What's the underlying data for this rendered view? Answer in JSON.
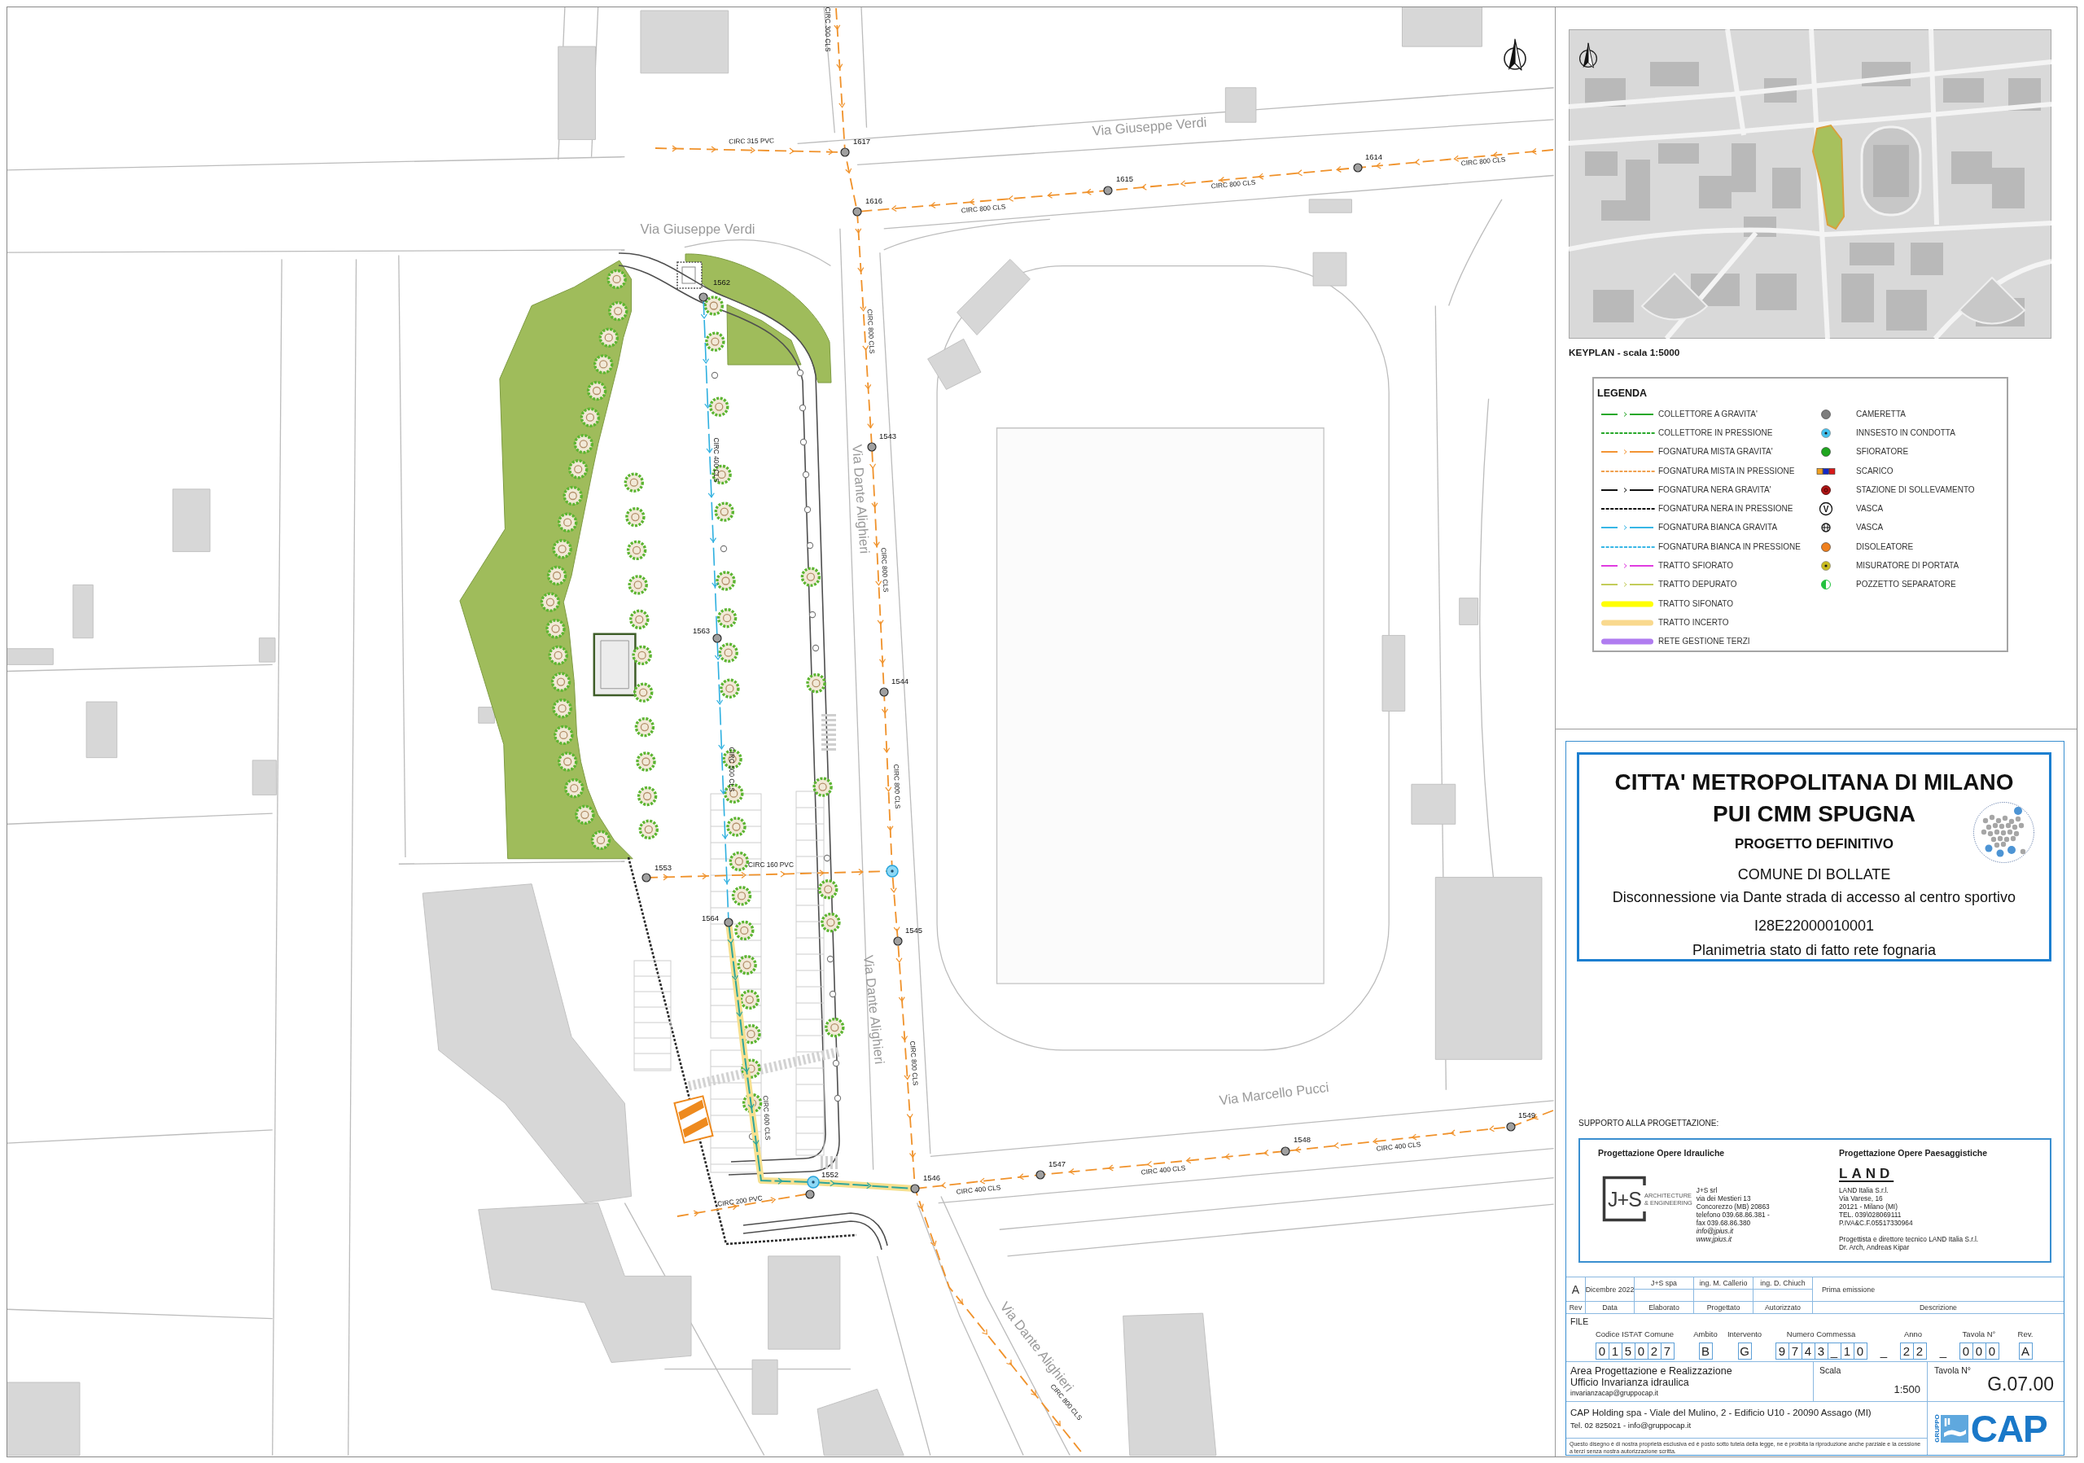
{
  "map": {
    "streets": [
      {
        "name": "Via Giuseppe Verdi"
      },
      {
        "name": "Via Giuseppe Verdi"
      },
      {
        "name": "Via Dante Alighieri"
      },
      {
        "name": "Via Dante Alighieri"
      },
      {
        "name": "Via Marcello Pucci"
      },
      {
        "name": "Via Dante Alighieri"
      }
    ],
    "pipes": [
      {
        "kind": "mista",
        "labels": [
          "CIRC 315 PVC"
        ]
      },
      {
        "kind": "mista",
        "labels": [
          "CIRC 800 CLS",
          "CIRC 800 CLS",
          "CIRC 800 CLS"
        ]
      },
      {
        "kind": "mista",
        "labels": [
          "CIRC 300 CLS",
          "CIRC 800 CLS",
          "CIRC 800 CLS",
          "CIRC 800 CLS",
          "CIRC 800 CLS",
          "CIRC 800 CLS"
        ]
      },
      {
        "kind": "mista",
        "labels": [
          "CIRC 400 CLS",
          "CIRC 400 CLS",
          "CIRC 400 CLS"
        ]
      },
      {
        "kind": "mista",
        "labels": [
          "CIRC 160 PVC"
        ]
      },
      {
        "kind": "mista",
        "labels": [
          "CIRC 200 PVC"
        ]
      },
      {
        "kind": "bianca",
        "labels": [
          "CIRC 400 CLS",
          "CIRC 500 CLS"
        ]
      },
      {
        "kind": "collettore",
        "labels": [
          "CIRC 600 CLS"
        ]
      }
    ],
    "nodes": [
      {
        "kind": "manhole",
        "label": "1617"
      },
      {
        "kind": "manhole",
        "label": "1616"
      },
      {
        "kind": "manhole",
        "label": "1615"
      },
      {
        "kind": "manhole",
        "label": "1614"
      },
      {
        "kind": "manhole",
        "label": "1562"
      },
      {
        "kind": "manhole",
        "label": "1543"
      },
      {
        "kind": "manhole",
        "label": "1563"
      },
      {
        "kind": "manhole",
        "label": "1544"
      },
      {
        "kind": "manhole",
        "label": "1553"
      },
      {
        "kind": "junction"
      },
      {
        "kind": "manhole",
        "label": "1545"
      },
      {
        "kind": "manhole",
        "label": "1564"
      },
      {
        "kind": "junction",
        "label": "1552"
      },
      {
        "kind": "manhole"
      },
      {
        "kind": "manhole",
        "label": "1546"
      },
      {
        "kind": "manhole",
        "label": "1547"
      },
      {
        "kind": "manhole",
        "label": "1548"
      },
      {
        "kind": "manhole",
        "label": "1549"
      }
    ]
  },
  "keyplan": {
    "caption": "KEYPLAN - scala 1:5000"
  },
  "legend": {
    "title": "LEGENDA",
    "lines": [
      {
        "label": "COLLETTORE A GRAVITA'",
        "kind": "gravity",
        "color": "#27a82a"
      },
      {
        "label": "COLLETTORE IN PRESSIONE",
        "kind": "pressure",
        "color": "#27a82a"
      },
      {
        "label": "FOGNATURA MISTA GRAVITA'",
        "kind": "gravity",
        "color": "#f39433"
      },
      {
        "label": "FOGNATURA MISTA IN PRESSIONE",
        "kind": "pressure",
        "color": "#f0a04e"
      },
      {
        "label": "FOGNATURA NERA GRAVITA'",
        "kind": "gravity",
        "color": "#111111"
      },
      {
        "label": "FOGNATURA NERA IN PRESSIONE",
        "kind": "pressure",
        "color": "#111111"
      },
      {
        "label": "FOGNATURA BIANCA GRAVITA",
        "kind": "gravity",
        "color": "#37b6e6"
      },
      {
        "label": "FOGNATURA BIANCA IN PRESSIONE",
        "kind": "pressure",
        "color": "#37b6e6"
      },
      {
        "label": "TRATTO SFIORATO",
        "kind": "gravity",
        "color": "#e03ce0"
      },
      {
        "label": "TRATTO DEPURATO",
        "kind": "gravity",
        "color": "#c3cc5a"
      },
      {
        "label": "TRATTO SIFONATO",
        "kind": "band",
        "color": "#ffff00"
      },
      {
        "label": "TRATTO INCERTO",
        "kind": "band",
        "color": "#f9d98e"
      },
      {
        "label": "RETE GESTIONE TERZI",
        "kind": "band",
        "color": "#b07cf0"
      }
    ],
    "symbols": [
      {
        "label": "CAMERETTA",
        "kind": "dot",
        "color": "#7d7d7d"
      },
      {
        "label": "INNSESTO IN CONDOTTA",
        "kind": "ring-dot",
        "color": "#45c3f0"
      },
      {
        "label": "SFIORATORE",
        "kind": "dot",
        "color": "#1fa61f"
      },
      {
        "label": "SCARICO",
        "kind": "squares"
      },
      {
        "label": "STAZIONE DI SOLLEVAMENTO",
        "kind": "pump",
        "color": "#b01515"
      },
      {
        "label": "VASCA",
        "kind": "letter",
        "mark": "V"
      },
      {
        "label": "VASCA",
        "kind": "grid"
      },
      {
        "label": "DISOLEATORE",
        "kind": "dot",
        "color": "#f0801e"
      },
      {
        "label": "MISURATORE DI PORTATA",
        "kind": "ring-dot",
        "color": "#c9bb1f"
      },
      {
        "label": "POZZETTO SEPARATORE",
        "kind": "half",
        "color": "#22c23e"
      }
    ]
  },
  "title_block": {
    "lines": [
      {
        "kind": "heading",
        "text": "CITTA' METROPOLITANA DI MILANO"
      },
      {
        "kind": "heading",
        "text": "PUI CMM SPUGNA"
      },
      {
        "kind": "subheading",
        "text": "PROGETTO DEFINITIVO"
      },
      {
        "kind": "text",
        "text": "COMUNE DI BOLLATE"
      },
      {
        "kind": "text",
        "text": "Disconnessione via Dante strada di accesso al centro sportivo"
      },
      {
        "kind": "text",
        "text": "I28E22000010001"
      },
      {
        "kind": "text",
        "text": "Planimetria stato di fatto rete fognaria"
      }
    ]
  },
  "support": {
    "title": "SUPPORTO ALLA PROGETTAZIONE:",
    "firms": [
      {
        "role": "Progettazione Opere Idrauliche",
        "logo": {
          "kind": "framed",
          "mark": "J+S",
          "tagline": [
            "ARCHITECTURE",
            "& ENGINEERING"
          ]
        },
        "address": [
          "J+S srl",
          "via dei Mestieri 13",
          "Concorezzo (MB) 20863",
          "telefono 039.68.86.381 -",
          "fax 039.68.86.380"
        ],
        "web": [
          "info@jpius.it",
          "www.jpius.it"
        ]
      },
      {
        "role": "Progettazione Opere Paesaggistiche",
        "logo": {
          "kind": "wordmark",
          "mark": "LAND"
        },
        "address": [
          "LAND Italia S.r.l.",
          "Via Varese, 16",
          "20121 - Milano (MI)",
          "TEL. 039\\028069111",
          "P.IVA&C.F.05517330964"
        ],
        "credits": [
          "Progettista e direttore tecnico LAND Italia S.r.l.",
          "Dr. Arch, Andreas Kipar"
        ]
      }
    ]
  },
  "revisions": {
    "rows": [
      {
        "rev": "A",
        "date": "Dicembre 2022",
        "drawn": "J+S spa",
        "designed": "ing. M. Callerio",
        "approved": "ing. D. Chiuch",
        "description": "Prima emissione"
      }
    ],
    "headers": [
      "Rev",
      "Data",
      "Elaborato",
      "Progettato",
      "Autorizzato",
      "Descrizione"
    ]
  },
  "file_code": {
    "title": "FILE",
    "groups": [
      {
        "kind": "field",
        "label": "Codice ISTAT Comune",
        "chars": [
          "0",
          "1",
          "5",
          "0",
          "2",
          "7"
        ]
      },
      {
        "kind": "field",
        "label": "Ambito",
        "chars": [
          "B"
        ]
      },
      {
        "kind": "field",
        "label": "Intervento",
        "chars": [
          "G"
        ]
      },
      {
        "kind": "field",
        "label": "Numero Commessa",
        "chars": [
          "9",
          "7",
          "4",
          "3",
          "_",
          "1",
          "0"
        ]
      },
      {
        "kind": "separator",
        "text": "_"
      },
      {
        "kind": "field",
        "label": "Anno",
        "chars": [
          "2",
          "2"
        ]
      },
      {
        "kind": "separator",
        "text": "_"
      },
      {
        "kind": "field",
        "label": "Tavola N°",
        "chars": [
          "0",
          "0",
          "0"
        ]
      },
      {
        "kind": "field",
        "label": "Rev.",
        "chars": [
          "A"
        ]
      }
    ]
  },
  "footer": {
    "office": [
      "Area Progettazione e Realizzazione",
      "Ufficio Invarianza idraulica"
    ],
    "email": "invarianzacap@gruppocap.it",
    "scale_label": "Scala",
    "scale": "1:500",
    "sheet_label": "Tavola N°",
    "sheet": "G.07.00",
    "address": "CAP Holding spa - Viale del Mulino, 2 - Edificio U10 - 20090 Assago (MI)",
    "contact": "Tel. 02 825021 - info@gruppocap.it",
    "logo": {
      "group": "GRUPPO",
      "name": "CAP"
    },
    "disclaimer": "Questo disegno è di nostra proprietà esclusiva ed è posto sotto tutela della legge, ne è proibita la riproduzione anche parziale e la cessione a terzi senza nostra autorizzazione scritta."
  }
}
